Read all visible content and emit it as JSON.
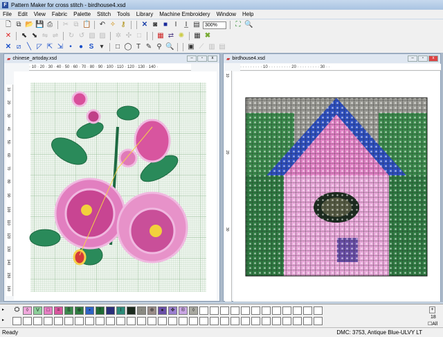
{
  "title": "Pattern Maker for cross stitch - birdhouse4.xsd",
  "menu": [
    "File",
    "Edit",
    "View",
    "Fabric",
    "Palette",
    "Stitch",
    "Tools",
    "Library",
    "Machine Embroidery",
    "Window",
    "Help"
  ],
  "toolbar": {
    "zoom": "300%"
  },
  "windows": [
    {
      "title": "chinese_artoday.xsd",
      "ruler": "· 10 · 20 · 30 · 40 · 50 · 60 · 70 · 80 · 90 · 100 · 110 · 120 · 130 · 140 ·",
      "vruler": [
        "10",
        "20",
        "30",
        "40",
        "50",
        "60",
        "70",
        "80",
        "90",
        "100",
        "110",
        "120",
        "130",
        "140",
        "150",
        "160"
      ]
    },
    {
      "title": "birdhouse4.xsd",
      "ruler": "· · · · · · · · · 10 · · · · · · · · · 20 · · · · · · · · · 30 · ·",
      "vruler": [
        "10",
        "20",
        "30"
      ]
    }
  ],
  "palette": {
    "swatches": [
      {
        "color": "#f0a8dc",
        "symbol": "◊"
      },
      {
        "color": "#8ccf9a",
        "symbol": "V"
      },
      {
        "color": "#e77fc4",
        "symbol": "□"
      },
      {
        "color": "#d9569e",
        "symbol": "="
      },
      {
        "color": "#3a8a4c",
        "symbol": "ß"
      },
      {
        "color": "#2e7b40",
        "symbol": "⊕"
      },
      {
        "color": "#2e63c4",
        "symbol": "▪"
      },
      {
        "color": "#1f6b35",
        "symbol": "†"
      },
      {
        "color": "#2a2f7a",
        "symbol": "·"
      },
      {
        "color": "#2b8a78",
        "symbol": "I"
      },
      {
        "color": "#1b2a1e",
        "symbol": ""
      },
      {
        "color": "#8a8a82",
        "symbol": "·"
      },
      {
        "color": "#9a8c88",
        "symbol": "⊕"
      },
      {
        "color": "#6a4fa8",
        "symbol": "●"
      },
      {
        "color": "#9b7fd0",
        "symbol": "✥"
      },
      {
        "color": "#c9a5e3",
        "symbol": "®"
      },
      {
        "color": "#a8a8a0",
        "symbol": "◊"
      }
    ],
    "empty_row1": 12,
    "empty_row2": 30,
    "count": "18",
    "all_label": "All"
  },
  "status": {
    "left": "Ready",
    "right": "DMC: 3753, Antique Blue-ULVY LT"
  }
}
